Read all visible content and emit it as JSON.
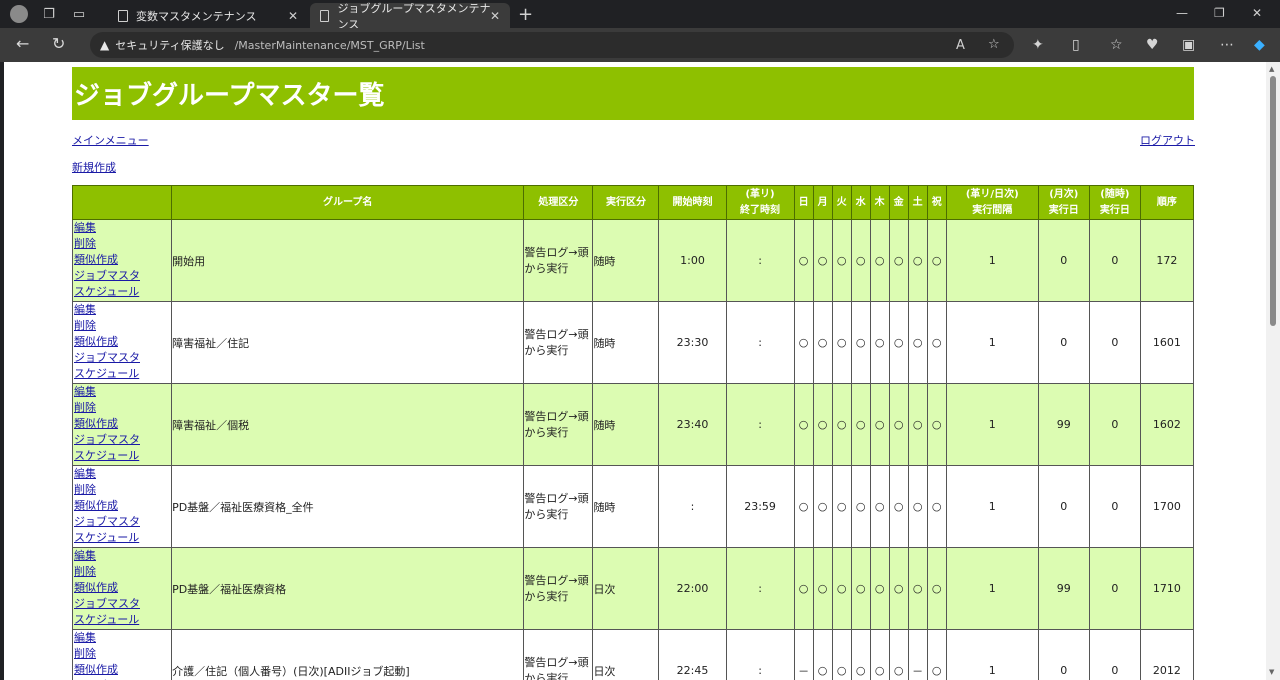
{
  "browser": {
    "tabs": [
      {
        "title": "変数マスタメンテナンス"
      },
      {
        "title": "ジョブグループマスタメンテナンス"
      }
    ],
    "security_label": "セキュリティ保護なし",
    "url": "/MasterMaintenance/MST_GRP/List"
  },
  "page": {
    "title": "ジョブグループマスター覧",
    "main_menu_link": "メインメニュー",
    "logout_link": "ログアウト",
    "new_link": "新規作成"
  },
  "table": {
    "headers": [
      "",
      "グループ名",
      "処理区分",
      "実行区分",
      "開始時刻",
      "(革リ)\n終了時刻",
      "日",
      "月",
      "火",
      "水",
      "木",
      "金",
      "土",
      "祝",
      "(革リ/日次)\n実行間隔",
      "(月次)\n実行日",
      "(随時)\n実行日",
      "順序"
    ],
    "row_actions": [
      "編集",
      "削除",
      "類似作成",
      "ジョブマスタ",
      "スケジュール"
    ],
    "rows": [
      {
        "group": "開始用",
        "proc": "警告ログ→頭から実行",
        "exec": "随時",
        "start": "1:00",
        "end": ":",
        "days": [
          "○",
          "○",
          "○",
          "○",
          "○",
          "○",
          "○",
          "○"
        ],
        "interval": "1",
        "monthly": "0",
        "adhoc": "0",
        "order": "172"
      },
      {
        "group": "障害福祉／住記",
        "proc": "警告ログ→頭から実行",
        "exec": "随時",
        "start": "23:30",
        "end": ":",
        "days": [
          "○",
          "○",
          "○",
          "○",
          "○",
          "○",
          "○",
          "○"
        ],
        "interval": "1",
        "monthly": "0",
        "adhoc": "0",
        "order": "1601"
      },
      {
        "group": "障害福祉／個税",
        "proc": "警告ログ→頭から実行",
        "exec": "随時",
        "start": "23:40",
        "end": ":",
        "days": [
          "○",
          "○",
          "○",
          "○",
          "○",
          "○",
          "○",
          "○"
        ],
        "interval": "1",
        "monthly": "99",
        "adhoc": "0",
        "order": "1602"
      },
      {
        "group": "PD基盤／福祉医療資格_全件",
        "proc": "警告ログ→頭から実行",
        "exec": "随時",
        "start": ":",
        "end": "23:59",
        "days": [
          "○",
          "○",
          "○",
          "○",
          "○",
          "○",
          "○",
          "○"
        ],
        "interval": "1",
        "monthly": "0",
        "adhoc": "0",
        "order": "1700"
      },
      {
        "group": "PD基盤／福祉医療資格",
        "proc": "警告ログ→頭から実行",
        "exec": "日次",
        "start": "22:00",
        "end": ":",
        "days": [
          "○",
          "○",
          "○",
          "○",
          "○",
          "○",
          "○",
          "○"
        ],
        "interval": "1",
        "monthly": "99",
        "adhoc": "0",
        "order": "1710"
      },
      {
        "group": "介護／住記（個人番号）(日次)[ADIIジョブ起動]",
        "proc": "警告ログ→頭から実行",
        "exec": "日次",
        "start": "22:45",
        "end": ":",
        "days": [
          "－",
          "○",
          "○",
          "○",
          "○",
          "○",
          "－",
          "○"
        ],
        "interval": "1",
        "monthly": "0",
        "adhoc": "0",
        "order": "2012"
      }
    ]
  }
}
